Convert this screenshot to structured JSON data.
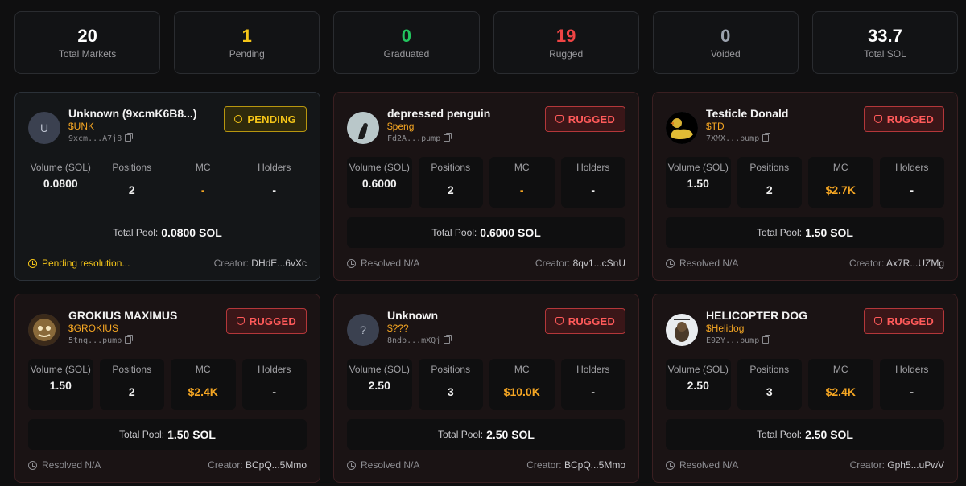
{
  "stats": [
    {
      "value": "20",
      "label": "Total Markets",
      "color": "#ffffff"
    },
    {
      "value": "1",
      "label": "Pending",
      "color": "#f5c518"
    },
    {
      "value": "0",
      "label": "Graduated",
      "color": "#22c55e"
    },
    {
      "value": "19",
      "label": "Rugged",
      "color": "#ef4444"
    },
    {
      "value": "0",
      "label": "Voided",
      "color": "#9ca3af"
    },
    {
      "value": "33.7",
      "label": "Total SOL",
      "color": "#ffffff"
    }
  ],
  "labels": {
    "volume": "Volume (SOL)",
    "positions": "Positions",
    "mc": "MC",
    "holders": "Holders",
    "total_pool": "Total Pool:",
    "creator": "Creator:"
  },
  "markets": [
    {
      "status": "pending",
      "badge": "PENDING",
      "name": "Unknown (9xcmK6B8...)",
      "ticker": "$UNK",
      "address": "9xcm...A7j8",
      "avatar_letter": "U",
      "avatar": "letter",
      "volume": "0.0800",
      "positions": "2",
      "mc": "-",
      "holders": "-",
      "pool": "0.0800 SOL",
      "resolved": "Pending resolution...",
      "creator": "DHdE...6vXc"
    },
    {
      "status": "rugged",
      "badge": "RUGGED",
      "name": "depressed penguin",
      "ticker": "$peng",
      "address": "Fd2A...pump",
      "avatar": "penguin",
      "volume": "0.6000",
      "positions": "2",
      "mc": "-",
      "holders": "-",
      "pool": "0.6000 SOL",
      "resolved": "Resolved N/A",
      "creator": "8qv1...cSnU"
    },
    {
      "status": "rugged",
      "badge": "RUGGED",
      "name": "Testicle Donald",
      "ticker": "$TD",
      "address": "7XMX...pump",
      "avatar": "duck",
      "volume": "1.50",
      "positions": "2",
      "mc": "$2.7K",
      "holders": "-",
      "pool": "1.50 SOL",
      "resolved": "Resolved N/A",
      "creator": "Ax7R...UZMg"
    },
    {
      "status": "rugged",
      "badge": "RUGGED",
      "name": "GROKIUS MAXIMUS",
      "ticker": "$GROKIUS",
      "address": "5tnq...pump",
      "avatar": "grok",
      "volume": "1.50",
      "positions": "2",
      "mc": "$2.4K",
      "holders": "-",
      "pool": "1.50 SOL",
      "resolved": "Resolved N/A",
      "creator": "BCpQ...5Mmo"
    },
    {
      "status": "rugged",
      "badge": "RUGGED",
      "name": "Unknown",
      "ticker": "$???",
      "address": "8ndb...mXQj",
      "avatar_letter": "?",
      "avatar": "letter",
      "volume": "2.50",
      "positions": "3",
      "mc": "$10.0K",
      "holders": "-",
      "pool": "2.50 SOL",
      "resolved": "Resolved N/A",
      "creator": "BCpQ...5Mmo"
    },
    {
      "status": "rugged",
      "badge": "RUGGED",
      "name": "HELICOPTER DOG",
      "ticker": "$Helidog",
      "address": "E92Y...pump",
      "avatar": "dog",
      "volume": "2.50",
      "positions": "3",
      "mc": "$2.4K",
      "holders": "-",
      "pool": "2.50 SOL",
      "resolved": "Resolved N/A",
      "creator": "Gph5...uPwV"
    }
  ]
}
